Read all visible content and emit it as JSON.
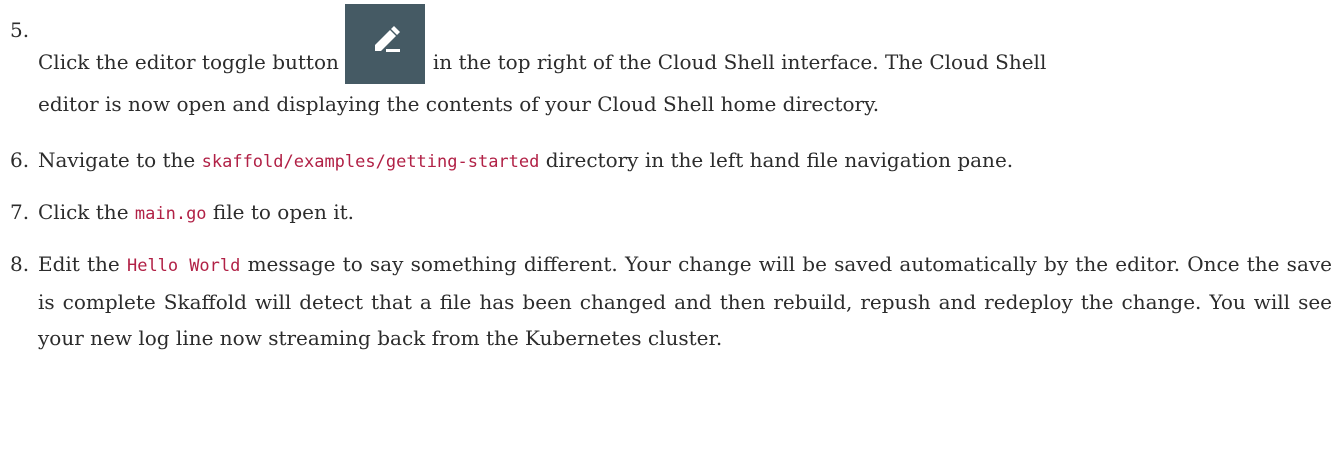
{
  "step5": {
    "number": "5.",
    "line1_text": "Click the editor toggle button",
    "line1_rest": "in the top right of the Cloud Shell interface. The Cloud Shell",
    "line2": "editor is now open and displaying the contents of your Cloud Shell home directory.",
    "icon": "pencil-icon",
    "icon_bg": "#455a64"
  },
  "step6": {
    "number": "6.",
    "pre": "Navigate to the",
    "code": "skaffold/examples/getting-started",
    "post": "directory in the left hand file navigation pane."
  },
  "step7": {
    "number": "7.",
    "pre": "Click the",
    "code": "main.go",
    "post": "file to open it."
  },
  "step8": {
    "number": "8.",
    "pre": "Edit the",
    "code": "Hello World",
    "post": "message to say something different. Your change will be saved automatically by the editor. Once the save is complete Skaffold will detect that a file has been changed and then rebuild, repush and redeploy the change. You will see your new log line now streaming back from the Kubernetes cluster."
  },
  "colors": {
    "code": "#b12146",
    "text": "#2c2c2c"
  }
}
